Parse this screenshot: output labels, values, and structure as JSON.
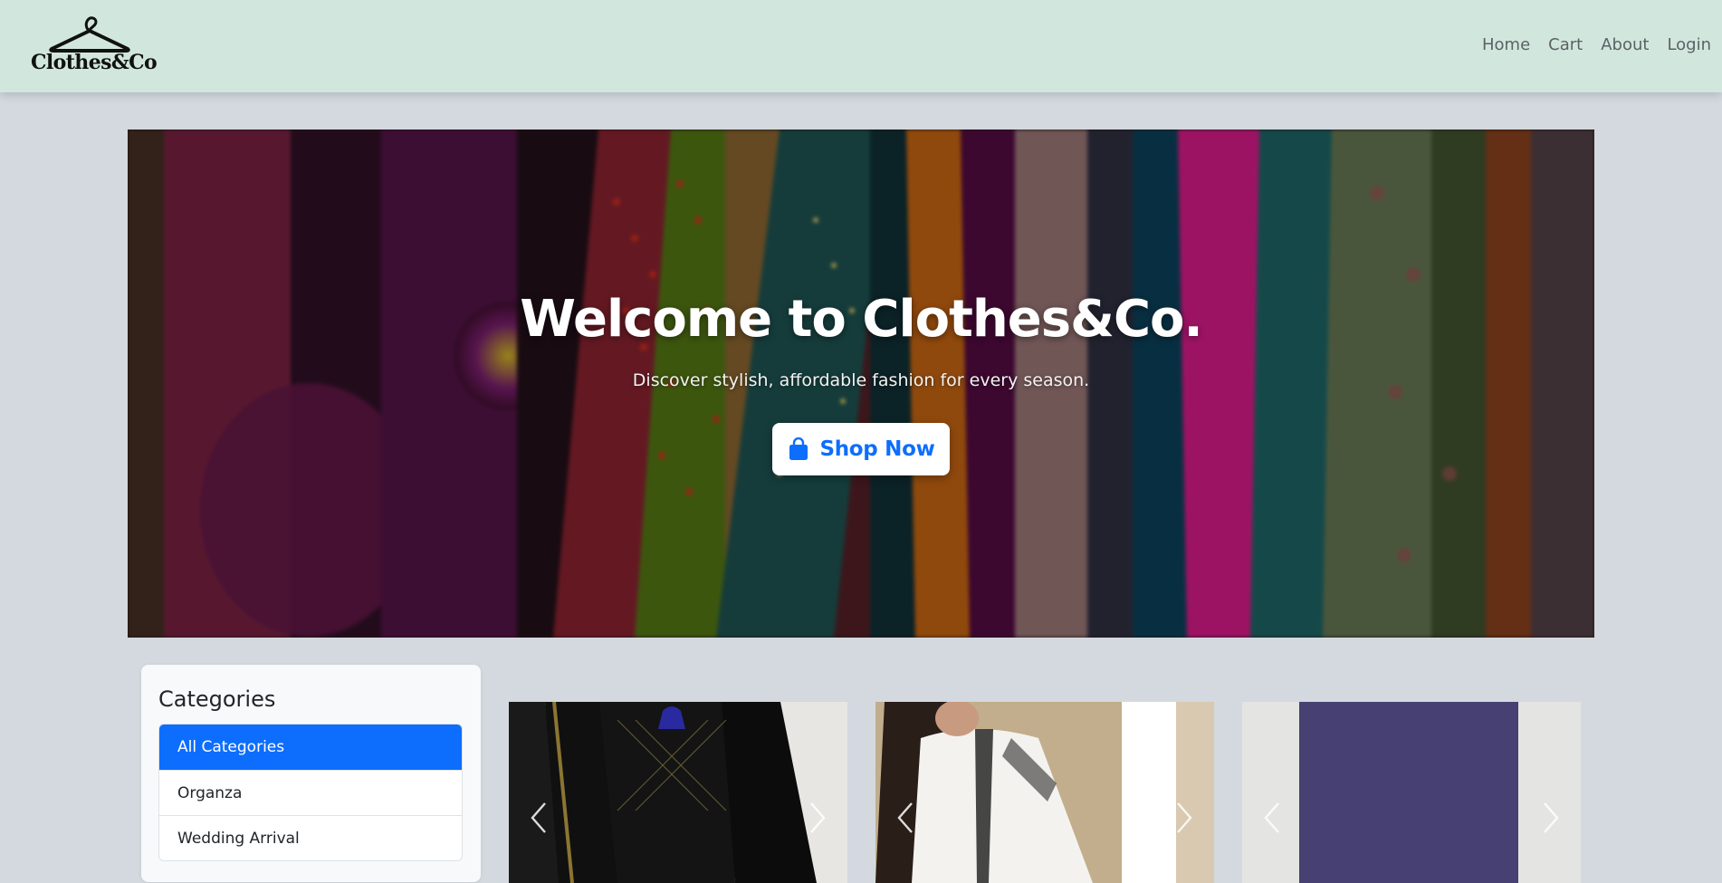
{
  "brand": {
    "name": "Clothes&Co",
    "icon": "hanger-icon"
  },
  "nav": {
    "links": [
      {
        "label": "Home"
      },
      {
        "label": "Cart"
      },
      {
        "label": "About"
      },
      {
        "label": "Login"
      }
    ]
  },
  "hero": {
    "title": "Welcome to Clothes&Co.",
    "subtitle": "Discover stylish, affordable fashion for every season.",
    "button": {
      "label": "Shop Now",
      "icon": "shopping-bag-icon"
    }
  },
  "categories": {
    "title": "Categories",
    "items": [
      {
        "label": "All Categories",
        "active": true
      },
      {
        "label": "Organza",
        "active": false
      },
      {
        "label": "Wedding Arrival",
        "active": false
      }
    ]
  },
  "products": [
    {
      "image": "black-embroidered-suit-with-dupatta",
      "prev_icon": "chevron-left-icon",
      "next_icon": "chevron-right-icon"
    },
    {
      "image": "white-embroidered-kurta",
      "prev_icon": "chevron-left-icon",
      "next_icon": "chevron-right-icon"
    },
    {
      "image": "purple-fabric-piece",
      "prev_icon": "chevron-left-icon",
      "next_icon": "chevron-right-icon"
    }
  ],
  "colors": {
    "navbar_bg": "#d1e7dd",
    "page_bg": "#d3d9df",
    "accent": "#0d6efd"
  }
}
